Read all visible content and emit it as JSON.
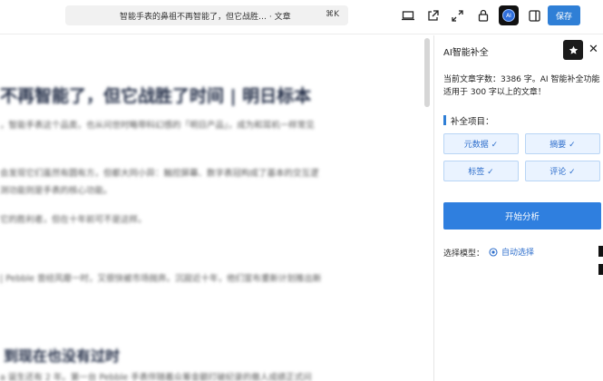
{
  "topbar": {
    "doc_title": "智能手表的鼻祖不再智能了，但它战胜…",
    "doc_type": "· 文章",
    "shortcut": "⌘K",
    "avatar_text": "AI",
    "save_label": "保存"
  },
  "article": {
    "heading": "不再智能了，但它战胜了时间 | 明日标本",
    "paragraphs": [
      "，智能手表这个品类，也从问世时略带科幻感的「明日产品」，成为和耳机一样常见",
      "会发现它们虽然有圆有方，但都大同小异：触控屏幕、数字表冠构成了基本的交互逻",
      "测功能则是手表的核心功能。",
      "它的胜利者，但在十年前可不是这样。",
      "| Pebble 曾经风靡一时，又很快被市场抛弃。沉寂近十年，他们宣布重新计划推出新",
      "a 诞生还有 2 年。第一台 Pebble 手表伴随着众筹金额打破纪录的傲人成绩正式问"
    ],
    "subheading": "到现在也没有过时"
  },
  "panel": {
    "title": "AI智能补全",
    "info": "当前文章字数：3386 字。AI 智能补全功能适用于 300 字以上的文章！",
    "section_title": "补全项目：",
    "options": [
      {
        "label": "元数据 ✓"
      },
      {
        "label": "摘要 ✓"
      },
      {
        "label": "标签 ✓"
      },
      {
        "label": "评论 ✓"
      }
    ],
    "start_label": "开始分析",
    "model_label": "选择模型：",
    "model_value": "自动选择"
  },
  "colors": {
    "accent": "#2f7fdf",
    "chip_bg": "#eaf3ff",
    "chip_text": "#2f6fcc"
  }
}
